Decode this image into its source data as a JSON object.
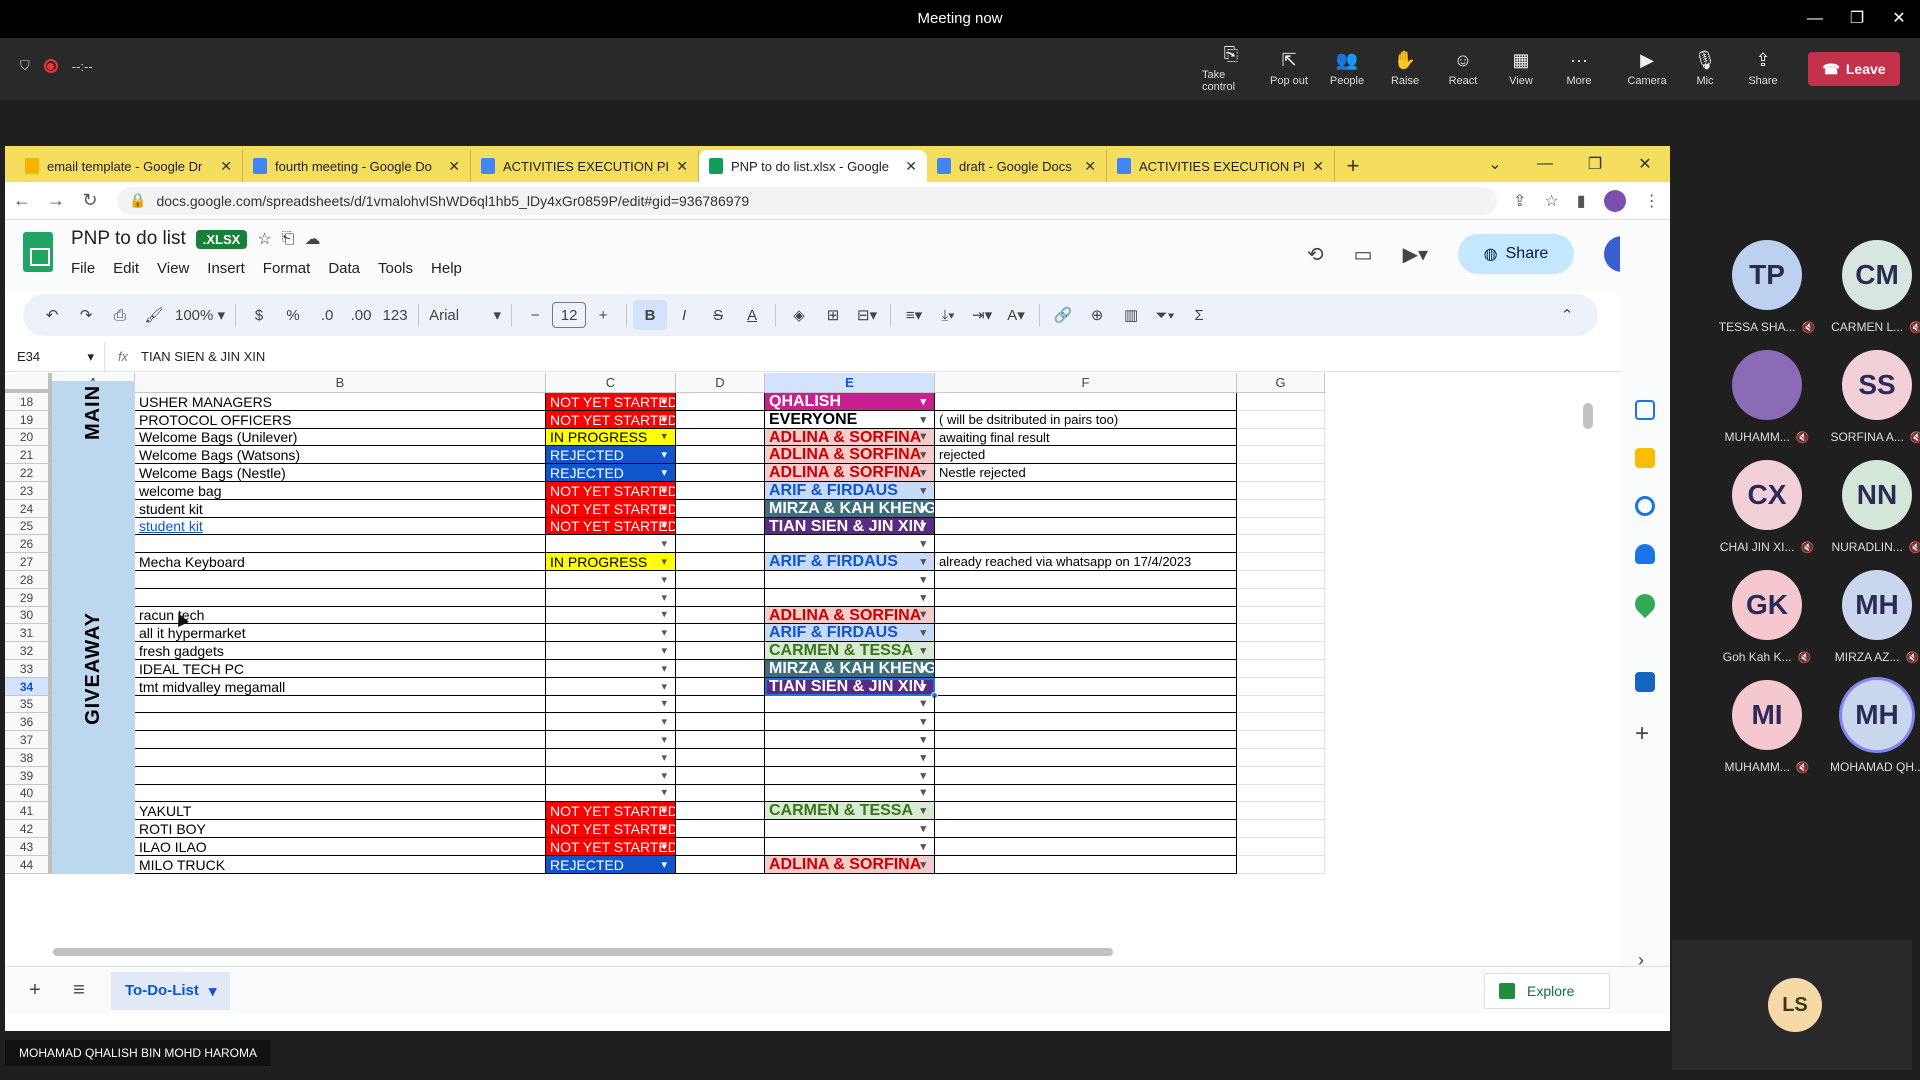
{
  "meeting": {
    "title": "Meeting now",
    "timer": "--:--",
    "tools": [
      {
        "label": "Take control",
        "icon": "take-control-icon",
        "glyph": "⎘"
      },
      {
        "label": "Pop out",
        "icon": "pop-out-icon",
        "glyph": "⇱"
      },
      {
        "label": "People",
        "icon": "people-icon",
        "glyph": "👥"
      },
      {
        "label": "Raise",
        "icon": "raise-hand-icon",
        "glyph": "✋"
      },
      {
        "label": "React",
        "icon": "react-icon",
        "glyph": "☺"
      },
      {
        "label": "View",
        "icon": "view-icon",
        "glyph": "▦"
      },
      {
        "label": "More",
        "icon": "more-icon",
        "glyph": "···"
      },
      {
        "label": "Camera",
        "icon": "camera-off-icon",
        "glyph": "▶"
      },
      {
        "label": "Mic",
        "icon": "mic-off-icon",
        "glyph": "🎙"
      },
      {
        "label": "Share",
        "icon": "share-icon",
        "glyph": "⇪"
      }
    ],
    "leave_label": "Leave",
    "presenter_name": "MOHAMAD QHALISH BIN MOHD HAROMA"
  },
  "browser": {
    "tabs": [
      {
        "title": "email template - Google Dr",
        "color": "#f4b400",
        "active": false
      },
      {
        "title": "fourth meeting - Google Do",
        "color": "#4285f4",
        "active": false
      },
      {
        "title": "ACTIVITIES EXECUTION PLA",
        "color": "#4285f4",
        "active": false
      },
      {
        "title": "PNP to do list.xlsx - Google",
        "color": "#0f9d58",
        "active": true
      },
      {
        "title": "draft - Google Docs",
        "color": "#4285f4",
        "active": false
      },
      {
        "title": "ACTIVITIES EXECUTION PLA",
        "color": "#4285f4",
        "active": false
      }
    ],
    "url": "docs.google.com/spreadsheets/d/1vmalohvlShWD6ql1hb5_lDy4xGr0859P/edit#gid=936786979"
  },
  "sheet": {
    "title": "PNP to do list",
    "badge": ".XLSX",
    "menus": [
      "File",
      "Edit",
      "View",
      "Insert",
      "Format",
      "Data",
      "Tools",
      "Help"
    ],
    "share_label": "Share",
    "zoom": "100%",
    "font": "Arial",
    "font_size": "12",
    "cell_ref": "E34",
    "formula": "TIAN SIEN & JIN XIN",
    "columns": [
      "A",
      "B",
      "C",
      "D",
      "E",
      "F",
      "G"
    ],
    "selected_column": "E",
    "selected_row": 34,
    "sections": [
      {
        "label": "MAIN",
        "color": "#bdd7ee"
      },
      {
        "label": "GIVEAWAY",
        "color": "#bdd7ee"
      }
    ],
    "rows": [
      {
        "n": 18,
        "task": "USHER MANAGERS",
        "status": "NOT YET STARTED",
        "assignee": "QHALISH",
        "note": ""
      },
      {
        "n": 19,
        "task": "PROTOCOL OFFICERS",
        "status": "NOT YET STARTED",
        "assignee": "EVERYONE",
        "note": "( will be dsitributed in pairs too)"
      },
      {
        "n": 20,
        "task": "Welcome Bags (Unilever)",
        "status": "IN PROGRESS",
        "assignee": "ADLINA & SORFINA",
        "note": "awaiting final result"
      },
      {
        "n": 21,
        "task": "Welcome Bags (Watsons)",
        "status": "REJECTED",
        "assignee": "ADLINA & SORFINA",
        "note": "rejected"
      },
      {
        "n": 22,
        "task": "Welcome Bags (Nestle)",
        "status": "REJECTED",
        "assignee": "ADLINA & SORFINA",
        "note": "Nestle rejected"
      },
      {
        "n": 23,
        "task": "welcome bag",
        "status": "NOT YET STARTED",
        "assignee": "ARIF & FIRDAUS",
        "note": ""
      },
      {
        "n": 24,
        "task": "student kit",
        "status": "NOT YET STARTED",
        "assignee": "MIRZA & KAH KHENG",
        "note": ""
      },
      {
        "n": 25,
        "task": "student kit ",
        "status": "NOT YET STARTED",
        "assignee": "TIAN SIEN & JIN XIN",
        "note": "",
        "link": true
      },
      {
        "n": 26,
        "task": "",
        "status": "",
        "assignee": "",
        "note": ""
      },
      {
        "n": 27,
        "task": "Mecha Keyboard",
        "status": "IN PROGRESS",
        "assignee": "ARIF & FIRDAUS",
        "note": "already reached via whatsapp on 17/4/2023"
      },
      {
        "n": 28,
        "task": "",
        "status": "",
        "assignee": "",
        "note": ""
      },
      {
        "n": 29,
        "task": "",
        "status": "",
        "assignee": "",
        "note": ""
      },
      {
        "n": 30,
        "task": "racun tech",
        "status": "",
        "assignee": "ADLINA & SORFINA",
        "note": ""
      },
      {
        "n": 31,
        "task": "all it hypermarket",
        "status": "",
        "assignee": "ARIF & FIRDAUS",
        "note": ""
      },
      {
        "n": 32,
        "task": "fresh gadgets",
        "status": "",
        "assignee": "CARMEN & TESSA",
        "note": ""
      },
      {
        "n": 33,
        "task": "IDEAL TECH PC",
        "status": "",
        "assignee": "MIRZA & KAH KHENG",
        "note": ""
      },
      {
        "n": 34,
        "task": "tmt midvalley megamall",
        "status": "",
        "assignee": "TIAN SIEN & JIN XIN",
        "note": ""
      },
      {
        "n": 35,
        "task": "",
        "status": "",
        "assignee": "",
        "note": ""
      },
      {
        "n": 36,
        "task": "",
        "status": "",
        "assignee": "",
        "note": ""
      },
      {
        "n": 37,
        "task": "",
        "status": "",
        "assignee": "",
        "note": ""
      },
      {
        "n": 38,
        "task": "",
        "status": "",
        "assignee": "",
        "note": ""
      },
      {
        "n": 39,
        "task": "",
        "status": "",
        "assignee": "",
        "note": ""
      },
      {
        "n": 40,
        "task": "",
        "status": "",
        "assignee": "",
        "note": ""
      },
      {
        "n": 41,
        "task": "YAKULT",
        "status": "NOT YET STARTED",
        "assignee": "CARMEN & TESSA",
        "note": ""
      },
      {
        "n": 42,
        "task": "ROTI BOY",
        "status": "NOT YET STARTED",
        "assignee": "",
        "note": ""
      },
      {
        "n": 43,
        "task": "ILAO ILAO",
        "status": "NOT YET STARTED",
        "assignee": "",
        "note": ""
      },
      {
        "n": 44,
        "task": "MILO TRUCK",
        "status": "REJECTED",
        "assignee": "ADLINA & SORFINA",
        "note": ""
      }
    ],
    "status_colors": {
      "NOT YET STARTED": {
        "bg": "#ff0000",
        "fg": "#ffffff"
      },
      "IN PROGRESS": {
        "bg": "#ffff00",
        "fg": "#000000"
      },
      "REJECTED": {
        "bg": "#1155cc",
        "fg": "#ffffff"
      }
    },
    "assignee_colors": {
      "QHALISH": {
        "bg": "#c8218f",
        "fg": "#ffffff"
      },
      "EVERYONE": {
        "bg": "#ffffff",
        "fg": "#000000"
      },
      "ADLINA & SORFINA": {
        "bg": "#f4cccc",
        "fg": "#cc0000"
      },
      "ARIF & FIRDAUS": {
        "bg": "#c9daf8",
        "fg": "#1155cc"
      },
      "MIRZA & KAH KHENG": {
        "bg": "#3d6e7c",
        "fg": "#ffffff"
      },
      "TIAN SIEN & JIN XIN": {
        "bg": "#5b2b83",
        "fg": "#ffffff"
      },
      "CARMEN & TESSA": {
        "bg": "#d9ead3",
        "fg": "#38761d"
      }
    },
    "sheet_tab": "To-Do-List",
    "explore_label": "Explore"
  },
  "participants": [
    {
      "initials": "TP",
      "name": "TESSA SHA...",
      "color": "#bcd0f0"
    },
    {
      "initials": "CM",
      "name": "CARMEN L...",
      "color": "#d8e6e0"
    },
    {
      "initials": "",
      "name": "MUHAMM...",
      "color": "#8a6bb5"
    },
    {
      "initials": "SS",
      "name": "SORFINA A...",
      "color": "#f2d0d8"
    },
    {
      "initials": "CX",
      "name": "CHAI JIN XI...",
      "color": "#f2d0d8"
    },
    {
      "initials": "NN",
      "name": "NURADLIN...",
      "color": "#d4e7d8"
    },
    {
      "initials": "GK",
      "name": "Goh Kah K...",
      "color": "#f5c8cf"
    },
    {
      "initials": "MH",
      "name": "MIRZA AZ...",
      "color": "#c9d6ee"
    },
    {
      "initials": "MI",
      "name": "MUHAMM...",
      "color": "#f5c8cf"
    },
    {
      "initials": "MH",
      "name": "MOHAMAD QH...",
      "color": "#c9d6ee"
    }
  ],
  "spotlight": {
    "initials": "LS"
  }
}
